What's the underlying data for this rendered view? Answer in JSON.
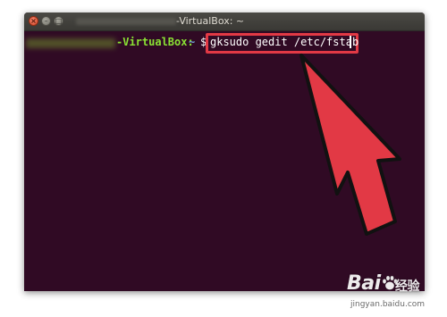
{
  "window": {
    "title": "-VirtualBox: ~",
    "buttons": {
      "close_icon": "close-icon",
      "minimize_icon": "minimize-icon",
      "maximize_icon": "maximize-icon",
      "close_glyph": "×",
      "minimize_glyph": "–",
      "maximize_glyph": "□"
    }
  },
  "terminal": {
    "prompt_host": "-VirtualBox:",
    "prompt_path": "~",
    "prompt_symbol": "$",
    "command": "gksudo gedit /etc/fstab"
  },
  "annotation": {
    "highlight_color": "#e23945",
    "arrow_color": "#e23945",
    "arrow_icon": "pointer-arrow-icon"
  },
  "watermark": {
    "logo_prefix": "Bai",
    "logo_suffix": "经验",
    "url": "jingyan.baidu.com"
  },
  "colors": {
    "terminal_bg": "#300a24",
    "prompt_host": "#8ae234",
    "prompt_path": "#729fcf"
  }
}
